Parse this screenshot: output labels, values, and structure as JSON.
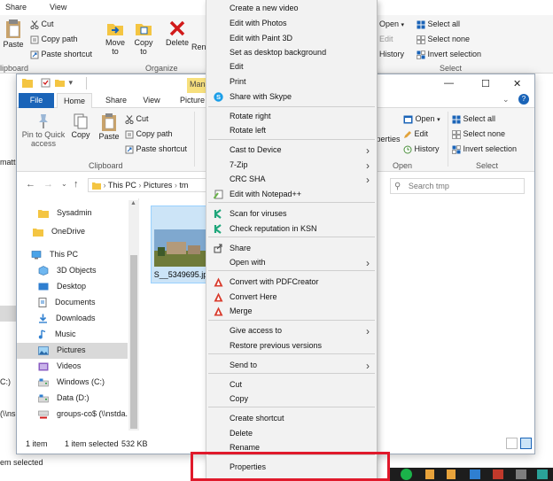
{
  "back_window": {
    "tabs": [
      "Share",
      "View"
    ],
    "ribbon": {
      "cut": "Cut",
      "copy_path": "Copy path",
      "paste_shortcut": "Paste shortcut",
      "paste": "Paste",
      "clipboard_group": "lipboard",
      "move_to": "Move\nto",
      "copy_to": "Copy\nto",
      "delete": "Delete",
      "rename": "Ren",
      "organize_group": "Organize",
      "open": "Open",
      "edit": "Edit",
      "history": "History",
      "select_all": "Select all",
      "select_none": "Select none",
      "invert_selection": "Invert selection",
      "select_group": "Select"
    },
    "left_edge": [
      "matt",
      "C:)",
      "(\\\\ns"
    ],
    "status": "em selected"
  },
  "front_window": {
    "manage_tab": "Mana",
    "tabs": {
      "file": "File",
      "home": "Home",
      "share": "Share",
      "view": "View",
      "picture": "Picture"
    },
    "ribbon": {
      "pin": "Pin to Quick\naccess",
      "copy": "Copy",
      "paste": "Paste",
      "cut": "Cut",
      "copy_path": "Copy path",
      "paste_shortcut": "Paste shortcut",
      "clipboard_group": "Clipboard",
      "properties": "perties",
      "open": "Open",
      "edit": "Edit",
      "history": "History",
      "open_group": "Open",
      "select_all": "Select all",
      "select_none": "Select none",
      "invert_selection": "Invert selection",
      "select_group": "Select"
    },
    "breadcrumb": [
      "This PC",
      "Pictures",
      "tm"
    ],
    "search_placeholder": "Search tmp",
    "nav": [
      {
        "label": "Sysadmin",
        "icon": "folder"
      },
      {
        "label": "OneDrive",
        "icon": "folder"
      },
      {
        "label": "This PC",
        "icon": "pc"
      },
      {
        "label": "3D Objects",
        "icon": "cube"
      },
      {
        "label": "Desktop",
        "icon": "desktop"
      },
      {
        "label": "Documents",
        "icon": "doc"
      },
      {
        "label": "Downloads",
        "icon": "download"
      },
      {
        "label": "Music",
        "icon": "music"
      },
      {
        "label": "Pictures",
        "icon": "pictures"
      },
      {
        "label": "Videos",
        "icon": "videos"
      },
      {
        "label": "Windows  (C:)",
        "icon": "drive"
      },
      {
        "label": "Data (D:)",
        "icon": "drive"
      },
      {
        "label": "groups-co$ (\\\\nstda.",
        "icon": "netdrive"
      },
      {
        "label": "Network",
        "icon": "network"
      }
    ],
    "file_label": "S__5349695.jp",
    "status": {
      "count": "1 item",
      "selected": "1 item selected",
      "size": "532 KB"
    }
  },
  "context_menu": {
    "items": [
      {
        "label": "Create a new video"
      },
      {
        "label": "Edit with Photos"
      },
      {
        "label": "Edit with Paint 3D"
      },
      {
        "label": "Set as desktop background"
      },
      {
        "label": "Edit"
      },
      {
        "label": "Print"
      },
      {
        "label": "Share with Skype",
        "icon": "skype"
      },
      {
        "label": "Rotate right"
      },
      {
        "label": "Rotate left"
      },
      {
        "label": "Cast to Device",
        "submenu": true
      },
      {
        "label": "7-Zip",
        "submenu": true
      },
      {
        "label": "CRC SHA",
        "submenu": true
      },
      {
        "label": "Edit with Notepad++",
        "icon": "notepad"
      },
      {
        "label": "Scan for viruses",
        "icon": "kaspersky"
      },
      {
        "label": "Check reputation in KSN",
        "icon": "kaspersky"
      },
      {
        "label": "Share",
        "icon": "share"
      },
      {
        "label": "Open with",
        "submenu": true
      },
      {
        "label": "Convert with PDFCreator",
        "icon": "pdfcreator"
      },
      {
        "label": "Convert Here",
        "icon": "pdfcreator"
      },
      {
        "label": "Merge",
        "icon": "pdfcreator"
      },
      {
        "label": "Give access to",
        "submenu": true
      },
      {
        "label": "Restore previous versions"
      },
      {
        "label": "Send to",
        "submenu": true
      },
      {
        "label": "Cut"
      },
      {
        "label": "Copy"
      },
      {
        "label": "Create shortcut"
      },
      {
        "label": "Delete"
      },
      {
        "label": "Rename"
      },
      {
        "label": "Properties"
      }
    ]
  },
  "colors": {
    "accent": "#1a64b8",
    "highlight_box": "#e0192b",
    "manage_tab": "#f7e07d",
    "selection": "#cce4f7"
  }
}
